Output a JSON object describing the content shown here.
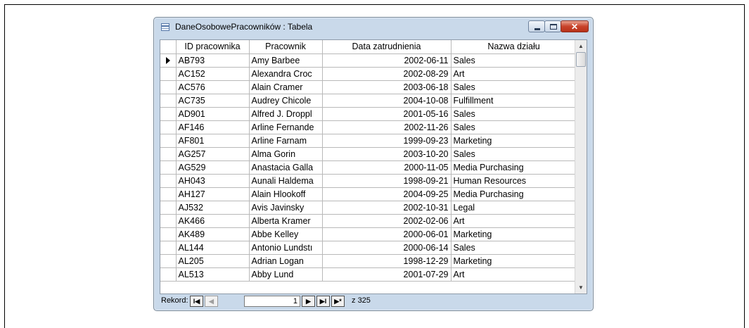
{
  "window": {
    "title": "DaneOsobowePracowników : Tabela"
  },
  "table": {
    "columns": [
      "ID pracownika",
      "Pracownik",
      "Data zatrudnienia",
      "Nazwa działu"
    ],
    "rows": [
      [
        "AB793",
        "Amy Barbee",
        "2002-06-11",
        "Sales"
      ],
      [
        "AC152",
        "Alexandra Croc",
        "2002-08-29",
        "Art"
      ],
      [
        "AC576",
        "Alain Cramer",
        "2003-06-18",
        "Sales"
      ],
      [
        "AC735",
        "Audrey Chicole",
        "2004-10-08",
        "Fulfillment"
      ],
      [
        "AD901",
        "Alfred J. Droppl",
        "2001-05-16",
        "Sales"
      ],
      [
        "AF146",
        "Arline Fernande",
        "2002-11-26",
        "Sales"
      ],
      [
        "AF801",
        "Arline Farnam",
        "1999-09-23",
        "Marketing"
      ],
      [
        "AG257",
        "Alma Gorin",
        "2003-10-20",
        "Sales"
      ],
      [
        "AG529",
        "Anastacia Galla",
        "2000-11-05",
        "Media Purchasing"
      ],
      [
        "AH043",
        "Aunali Haldema",
        "1998-09-21",
        "Human Resources"
      ],
      [
        "AH127",
        "Alain Hlookoff",
        "2004-09-25",
        "Media Purchasing"
      ],
      [
        "AJ532",
        "Avis Javinsky",
        "2002-10-31",
        "Legal"
      ],
      [
        "AK466",
        "Alberta Kramer",
        "2002-02-06",
        "Art"
      ],
      [
        "AK489",
        "Abbe Kelley",
        "2000-06-01",
        "Marketing"
      ],
      [
        "AL144",
        "Antonio Lundstı",
        "2000-06-14",
        "Sales"
      ],
      [
        "AL205",
        "Adrian Logan",
        "1998-12-29",
        "Marketing"
      ],
      [
        "AL513",
        "Abby Lund",
        "2001-07-29",
        "Art"
      ]
    ],
    "current_row_index": 0
  },
  "navigation": {
    "label": "Rekord:",
    "current_record": "1",
    "total_prefix": "z",
    "total_records": "325",
    "first_glyph": "I◀",
    "prev_glyph": "◀",
    "next_glyph": "▶",
    "last_glyph": "▶I",
    "new_glyph": "▶*"
  },
  "icons": {
    "window": "table-icon",
    "minimize": "minimize-icon",
    "maximize": "maximize-icon",
    "close": "close-icon",
    "record_selector": "current-record-arrow-icon"
  }
}
